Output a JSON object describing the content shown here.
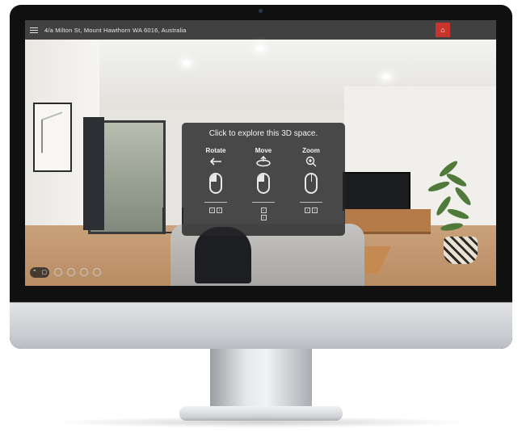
{
  "address_bar": {
    "menu_icon": "hamburger-icon",
    "address": "4/a Milton St, Mount Hawthorn WA 6016, Australia"
  },
  "brand": {
    "logo_icon": "house-logo-icon",
    "accent_color": "#c7342b"
  },
  "overlay": {
    "title": "Click to explore this 3D space.",
    "columns": [
      {
        "label": "Rotate",
        "gesture_icon": "arrow-left-icon",
        "mouse_icon": "mouse-left-button-icon",
        "keys": [
          "‹",
          "›"
        ]
      },
      {
        "label": "Move",
        "gesture_icon": "circular-arrow-icon",
        "mouse_icon": "mouse-left-button-icon",
        "keys": [
          "‹",
          "›"
        ]
      },
      {
        "label": "Zoom",
        "gesture_icon": "zoom-in-icon",
        "mouse_icon": "mouse-scroll-icon",
        "keys": [
          "‹",
          "›"
        ]
      }
    ]
  },
  "bottom_controls": {
    "icons": [
      "chevron-up-icon",
      "floor-plan-icon",
      "person-icon",
      "dollhouse-icon",
      "measure-icon",
      "settings-icon"
    ]
  }
}
